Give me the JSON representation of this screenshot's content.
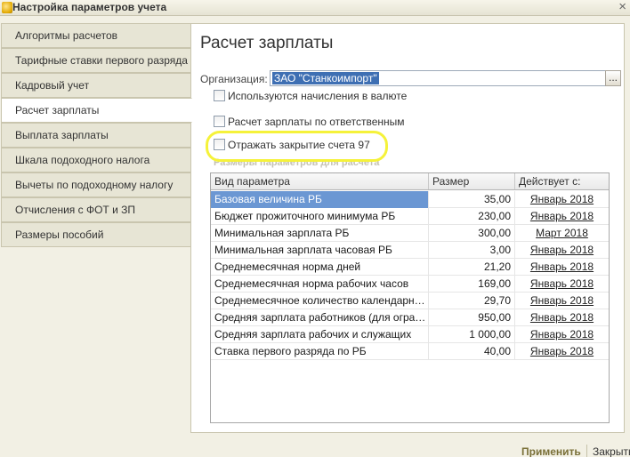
{
  "window": {
    "title": "Настройка параметров учета",
    "close_glyph": "×"
  },
  "sidebar": {
    "items": [
      {
        "label": "Алгоритмы расчетов",
        "active": false
      },
      {
        "label": "Тарифные ставки первого разряда",
        "active": false
      },
      {
        "label": "Кадровый учет",
        "active": false
      },
      {
        "label": "Расчет зарплаты",
        "active": true
      },
      {
        "label": "Выплата зарплаты",
        "active": false
      },
      {
        "label": "Шкала подоходного налога",
        "active": false
      },
      {
        "label": "Вычеты по подоходному налогу",
        "active": false
      },
      {
        "label": "Отчисления с ФОТ и ЗП",
        "active": false
      },
      {
        "label": "Размеры пособий",
        "active": false
      }
    ]
  },
  "main": {
    "title": "Расчет зарплаты",
    "organization": {
      "label": "Организация:",
      "value": "ЗАО \"Станкоимпорт\"",
      "select_button": "..."
    },
    "checkboxes": [
      {
        "label": "Используются начисления в валюте",
        "checked": false
      },
      {
        "label": "Расчет зарплаты по ответственным",
        "checked": false
      },
      {
        "label": "Отражать закрытие счета 97",
        "checked": false
      }
    ],
    "group_label": "Размеры параметров для расчета",
    "highlight_color": "#f5f23a",
    "table": {
      "columns": [
        "Вид параметра",
        "Размер",
        "Действует с:"
      ],
      "rows": [
        {
          "name": "Базовая величина РБ",
          "value": "35,00",
          "date": "Январь 2018",
          "selected": true
        },
        {
          "name": "Бюджет прожиточного минимума РБ",
          "value": "230,00",
          "date": "Январь 2018",
          "selected": false
        },
        {
          "name": "Минимальная зарплата РБ",
          "value": "300,00",
          "date": "Март 2018",
          "selected": false
        },
        {
          "name": "Минимальная зарплата часовая РБ",
          "value": "3,00",
          "date": "Январь 2018",
          "selected": false
        },
        {
          "name": "Среднемесячная норма дней",
          "value": "21,20",
          "date": "Январь 2018",
          "selected": false
        },
        {
          "name": "Среднемесячная норма рабочих часов",
          "value": "169,00",
          "date": "Январь 2018",
          "selected": false
        },
        {
          "name": "Среднемесячное количество календарных д...",
          "value": "29,70",
          "date": "Январь 2018",
          "selected": false
        },
        {
          "name": "Средняя зарплата работников (для огранич...",
          "value": "950,00",
          "date": "Январь 2018",
          "selected": false
        },
        {
          "name": "Средняя зарплата рабочих и служащих",
          "value": "1 000,00",
          "date": "Январь 2018",
          "selected": false
        },
        {
          "name": "Ставка первого разряда по РБ",
          "value": "40,00",
          "date": "Январь 2018",
          "selected": false
        }
      ]
    }
  },
  "footer": {
    "apply_label": "Применить",
    "close_label": "Закрыть"
  }
}
